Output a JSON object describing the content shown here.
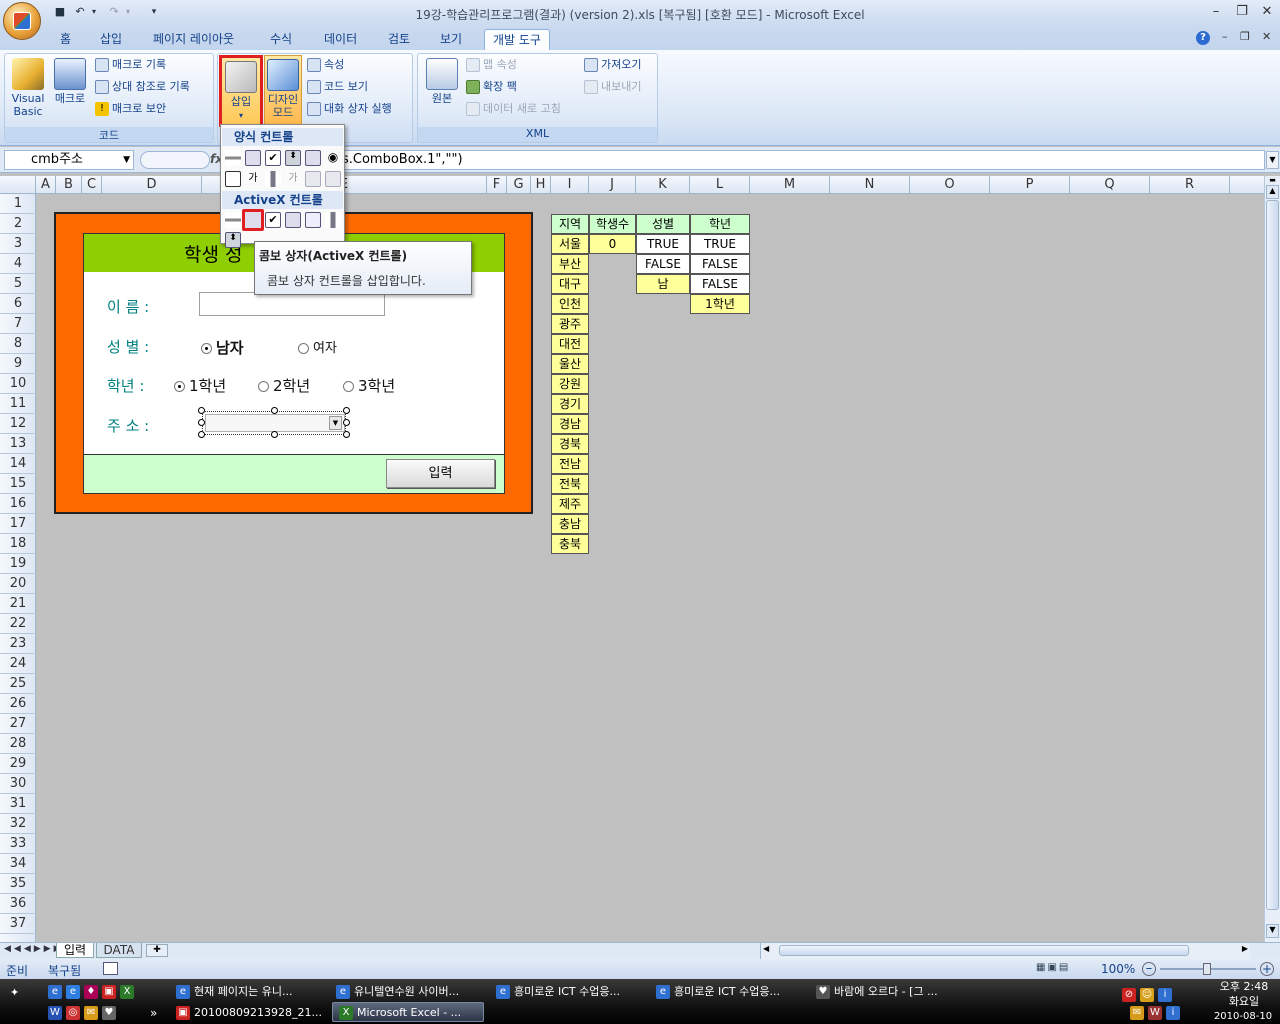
{
  "window": {
    "title": "19강-학습관리프로그램(결과) (version 2).xls [복구됨]  [호환 모드] - Microsoft Excel"
  },
  "ribbon_tabs": [
    "홈",
    "삽입",
    "페이지 레이아웃",
    "수식",
    "데이터",
    "검토",
    "보기",
    "개발 도구"
  ],
  "active_tab": "개발 도구",
  "ribbon": {
    "code_group": {
      "title": "코드",
      "visual_basic": "Visual Basic",
      "macro": "매크로",
      "record_macro": "매크로 기록",
      "relative_ref": "상대 참조로 기록",
      "macro_security": "매크로 보안"
    },
    "controls_group": {
      "insert": "삽입",
      "design_mode": "디자인 모드",
      "properties": "속성",
      "view_code": "코드 보기",
      "run_dialog": "대화 상자 실행"
    },
    "xml_group": {
      "title": "XML",
      "source": "원본",
      "map_properties": "맵 속성",
      "expansion_packs": "확장 팩",
      "refresh_data": "데이터 새로 고침",
      "import": "가져오기",
      "export": "내보내기"
    }
  },
  "insert_popup": {
    "form_controls": "양식 컨트롤",
    "activex_controls": "ActiveX 컨트롤",
    "tooltip_title": "콤보 상자(ActiveX 컨트롤)",
    "tooltip_desc": "콤보 상자 컨트롤을 삽입합니다."
  },
  "formula_bar": {
    "name_box": "cmb주소",
    "fx": "fx",
    "formula": "s.ComboBox.1\",\"\")"
  },
  "columns": [
    "A",
    "B",
    "C",
    "D",
    "E",
    "F",
    "G",
    "H",
    "I",
    "J",
    "K",
    "L",
    "M",
    "N",
    "O",
    "P",
    "Q",
    "R"
  ],
  "rows": [
    "1",
    "2",
    "3",
    "4",
    "5",
    "6",
    "7",
    "8",
    "9",
    "10",
    "11",
    "12",
    "13",
    "14",
    "15",
    "16",
    "17",
    "18",
    "19",
    "20",
    "21",
    "22",
    "23",
    "24",
    "25",
    "26",
    "27",
    "28",
    "29",
    "30",
    "31",
    "32",
    "33",
    "34",
    "35",
    "36",
    "37"
  ],
  "form": {
    "title": "학생 성",
    "name_label": "이      름 :",
    "gender_label": "성      별 :",
    "male": "남자",
    "female": "여자",
    "grade_label": "학년 :",
    "grade1": "1학년",
    "grade2": "2학년",
    "grade3": "3학년",
    "address_label": "주      소 :",
    "submit": "입력"
  },
  "data_table": {
    "headers": [
      "지역",
      "학생수",
      "성별",
      "학년"
    ],
    "regions": [
      "서울",
      "부산",
      "대구",
      "인천",
      "광주",
      "대전",
      "울산",
      "강원",
      "경기",
      "경남",
      "경북",
      "전남",
      "전북",
      "제주",
      "충남",
      "충북"
    ],
    "student_count": "0",
    "gender_values": [
      "TRUE",
      "FALSE",
      "남"
    ],
    "grade_values": [
      "TRUE",
      "FALSE",
      "FALSE",
      "1학년"
    ]
  },
  "sheets": [
    "입력",
    "DATA"
  ],
  "status": {
    "ready": "준비",
    "recovered": "복구됨",
    "zoom": "100%"
  },
  "taskbar": {
    "items_row1": [
      "현재 페이지는 유니...",
      "유니텔연수원 사이버...",
      "흥미로운 ICT 수업응...",
      "흥미로운 ICT 수업응...",
      "바람에 오르다 - [그 ..."
    ],
    "items_row2": [
      "20100809213928_21...",
      "Microsoft Excel - ..."
    ],
    "clock_time": "오후 2:48",
    "clock_day": "화요일",
    "clock_date": "2010-08-10"
  },
  "colors": {
    "form_border": "#ff6a00",
    "form_header": "#8fce00",
    "form_footer": "#ccffcc",
    "cell_yellow": "#ffff99",
    "header_green": "#ccffcc",
    "highlight_red": "#e02020"
  }
}
